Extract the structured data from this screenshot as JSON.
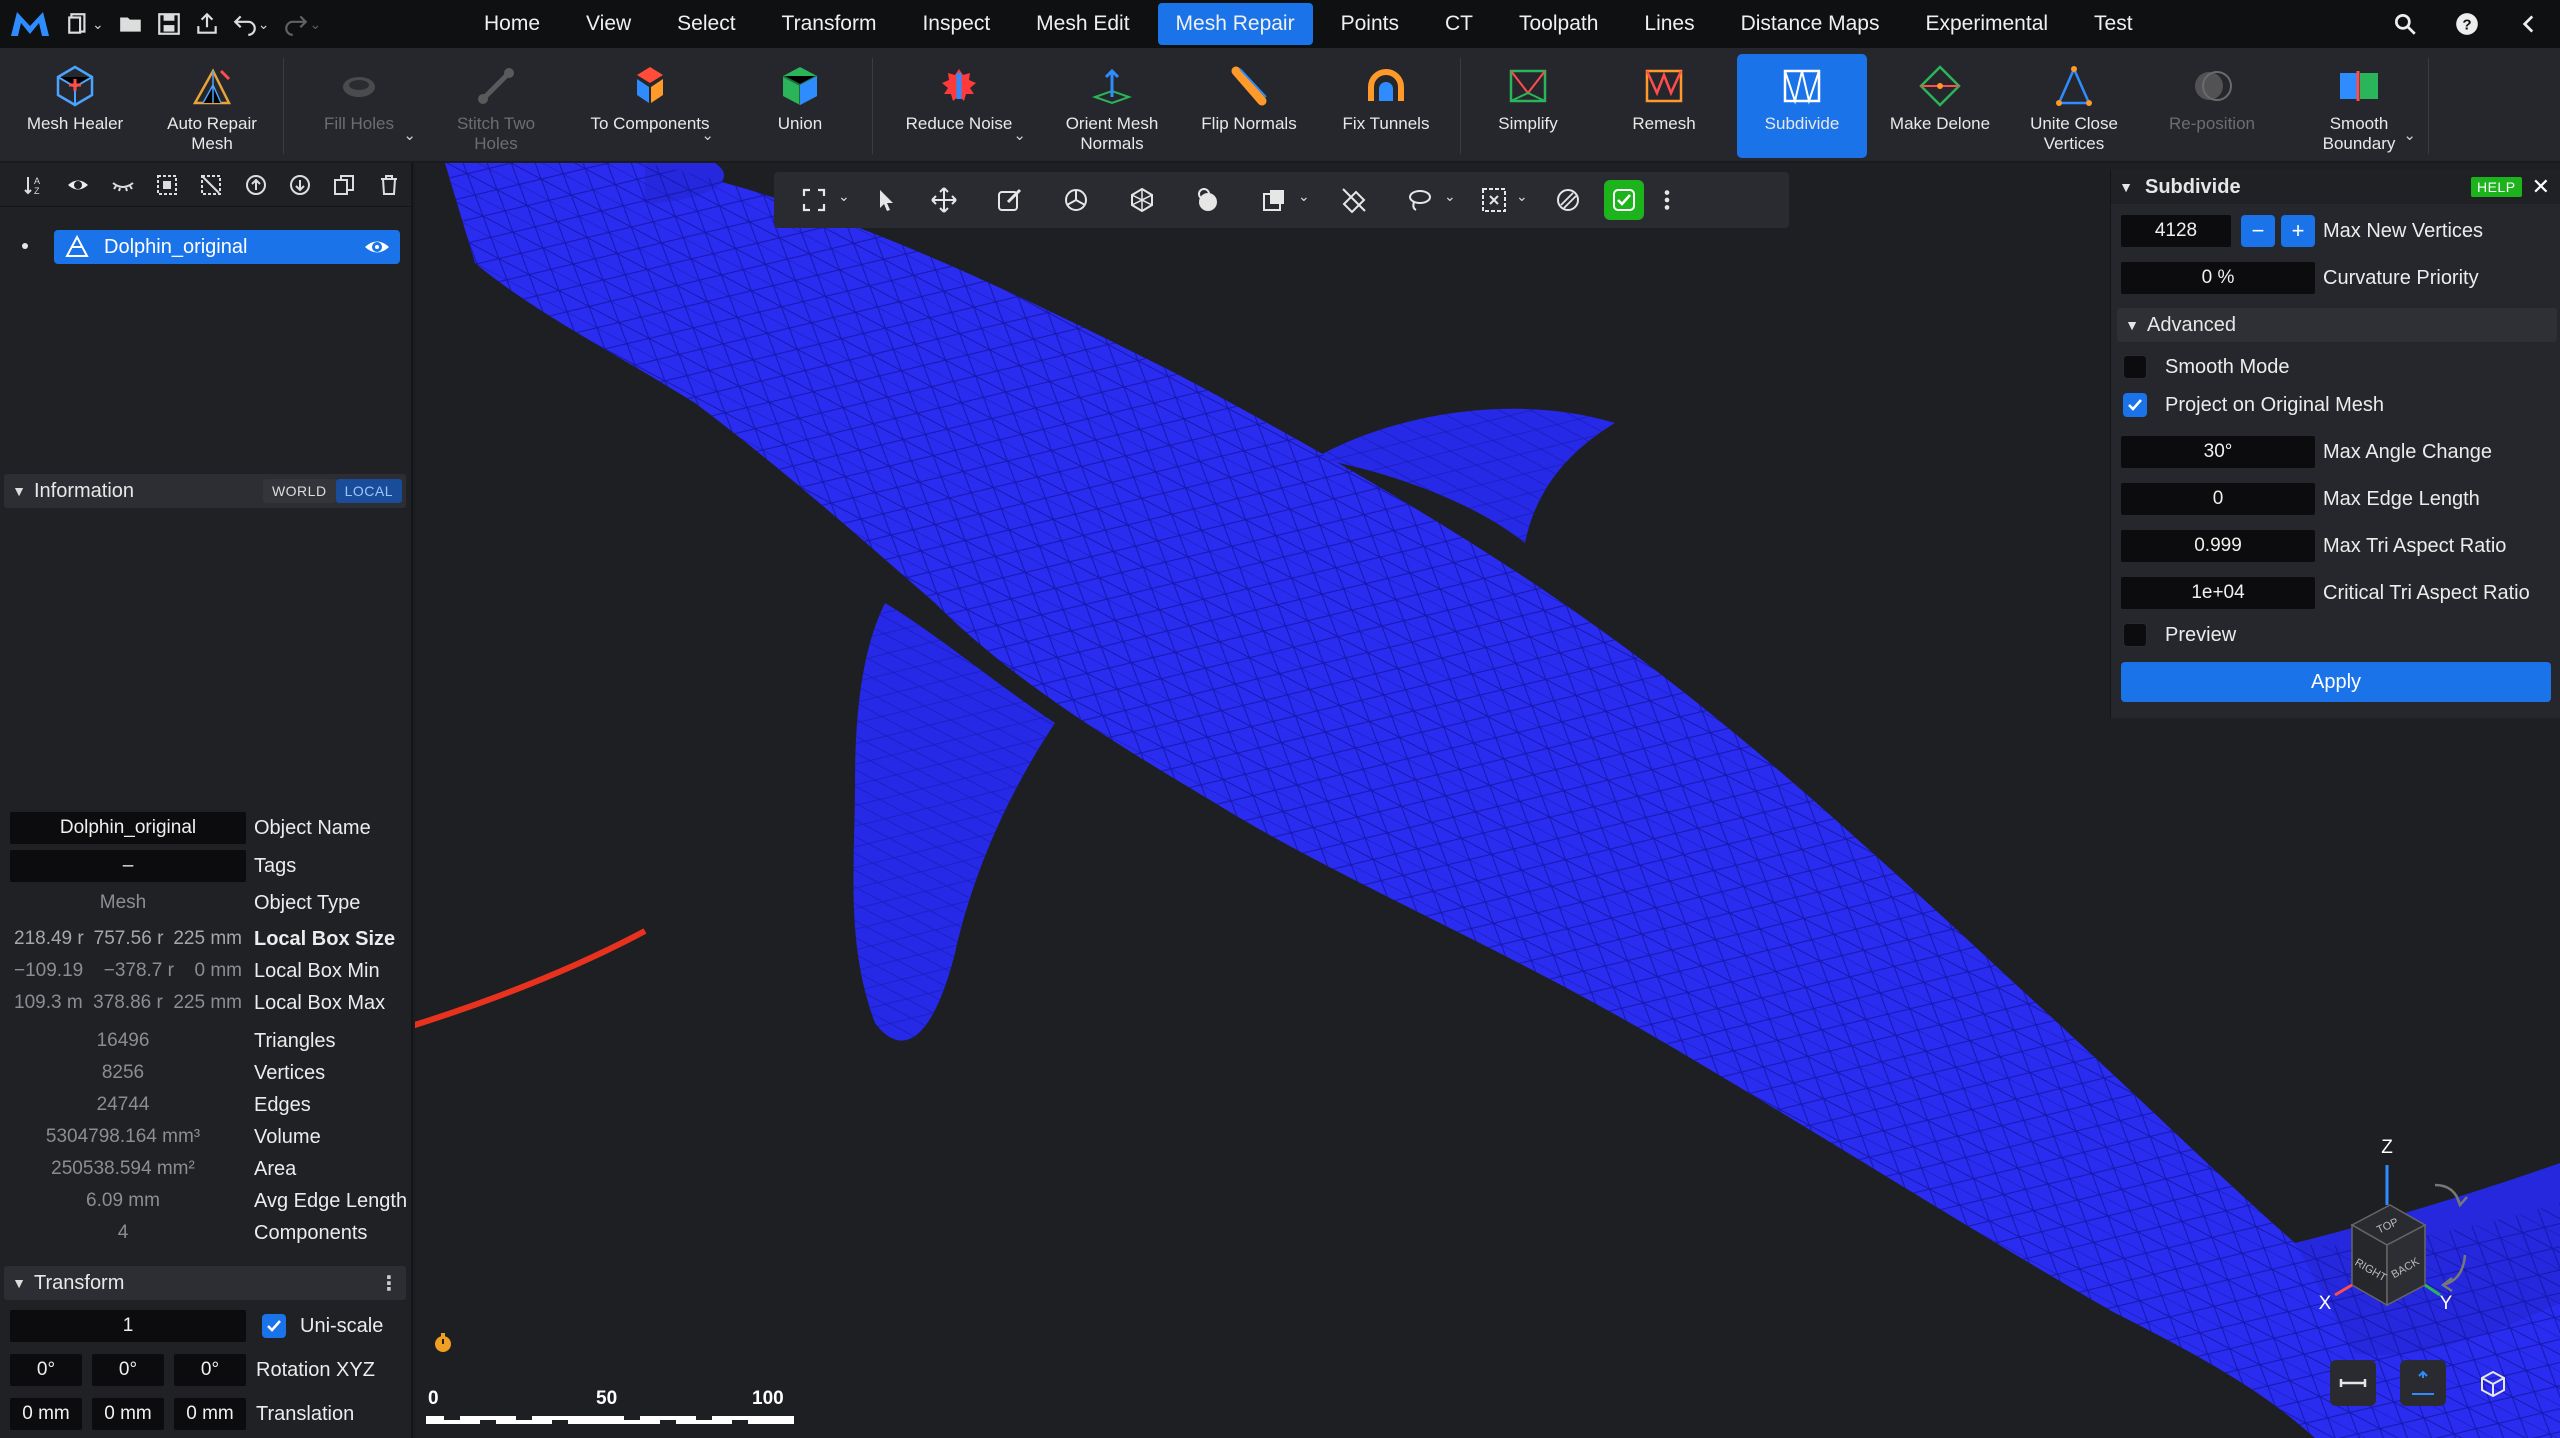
{
  "menubar": {
    "tabs": [
      "Home",
      "View",
      "Select",
      "Transform",
      "Inspect",
      "Mesh Edit",
      "Mesh Repair",
      "Points",
      "CT",
      "Toolpath",
      "Lines",
      "Distance Maps",
      "Experimental",
      "Test"
    ],
    "active_tab": "Mesh Repair",
    "accent": "#1a73e8"
  },
  "ribbon": {
    "mesh_healer": "Mesh Healer",
    "auto_repair": "Auto Repair Mesh",
    "fill_holes": "Fill Holes",
    "stitch": "Stitch Two Holes",
    "to_components": "To Components",
    "union": "Union",
    "reduce_noise": "Reduce Noise",
    "orient_normals": "Orient Mesh Normals",
    "flip_normals": "Flip Normals",
    "fix_tunnels": "Fix Tunnels",
    "simplify": "Simplify",
    "remesh": "Remesh",
    "subdivide": "Subdivide",
    "make_delone": "Make Delone",
    "unite_vertices": "Unite Close Vertices",
    "reposition": "Re-position",
    "smooth_boundary": "Smooth Boundary"
  },
  "scene": {
    "object_name": "Dolphin_original"
  },
  "information": {
    "title": "Information",
    "world_label": "WORLD",
    "local_label": "LOCAL",
    "object_name_value": "Dolphin_original",
    "object_name_label": "Object Name",
    "tags_value": "–",
    "tags_label": "Tags",
    "object_type_value": "Mesh",
    "object_type_label": "Object Type",
    "box_size": [
      "218.49 r",
      "757.56 r",
      "225 mm"
    ],
    "box_size_label": "Local Box Size",
    "box_min": [
      "−109.19",
      "−378.7 r",
      "0 mm"
    ],
    "box_min_label": "Local Box Min",
    "box_max": [
      "109.3 m",
      "378.86 r",
      "225 mm"
    ],
    "box_max_label": "Local Box Max",
    "triangles": "16496",
    "triangles_label": "Triangles",
    "vertices": "8256",
    "vertices_label": "Vertices",
    "edges": "24744",
    "edges_label": "Edges",
    "volume": "5304798.164 mm³",
    "volume_label": "Volume",
    "area": "250538.594 mm²",
    "area_label": "Area",
    "avg_edge": "6.09 mm",
    "avg_edge_label": "Avg Edge Length",
    "components": "4",
    "components_label": "Components"
  },
  "transform": {
    "title": "Transform",
    "scale_value": "1",
    "uniscale_label": "Uni-scale",
    "uniscale_checked": true,
    "rotation": [
      "0°",
      "0°",
      "0°"
    ],
    "rotation_label": "Rotation XYZ",
    "translation": [
      "0 mm",
      "0 mm",
      "0 mm"
    ],
    "translation_label": "Translation"
  },
  "subdivide": {
    "title": "Subdivide",
    "help": "HELP",
    "max_new_vertices": "4128",
    "max_new_vertices_label": "Max New Vertices",
    "curvature_priority": "0 %",
    "curvature_priority_label": "Curvature Priority",
    "advanced_label": "Advanced",
    "smooth_mode_label": "Smooth Mode",
    "smooth_mode_checked": false,
    "project_label": "Project on Original Mesh",
    "project_checked": true,
    "max_angle_change": "30°",
    "max_angle_change_label": "Max Angle Change",
    "max_edge_length": "0",
    "max_edge_length_label": "Max Edge Length",
    "max_tri_aspect": "0.999",
    "max_tri_aspect_label": "Max Tri Aspect Ratio",
    "critical_tri_aspect": "1e+04",
    "critical_tri_aspect_label": "Critical Tri Aspect Ratio",
    "preview_label": "Preview",
    "preview_checked": false,
    "apply_label": "Apply"
  },
  "scale_bar": {
    "ticks": [
      "0",
      "50",
      "100"
    ]
  },
  "viewcube": {
    "faces": [
      "TOP",
      "RIGHT",
      "BACK"
    ],
    "axes": [
      "X",
      "Y",
      "Z"
    ]
  },
  "mesh_color": "#2a2df0"
}
